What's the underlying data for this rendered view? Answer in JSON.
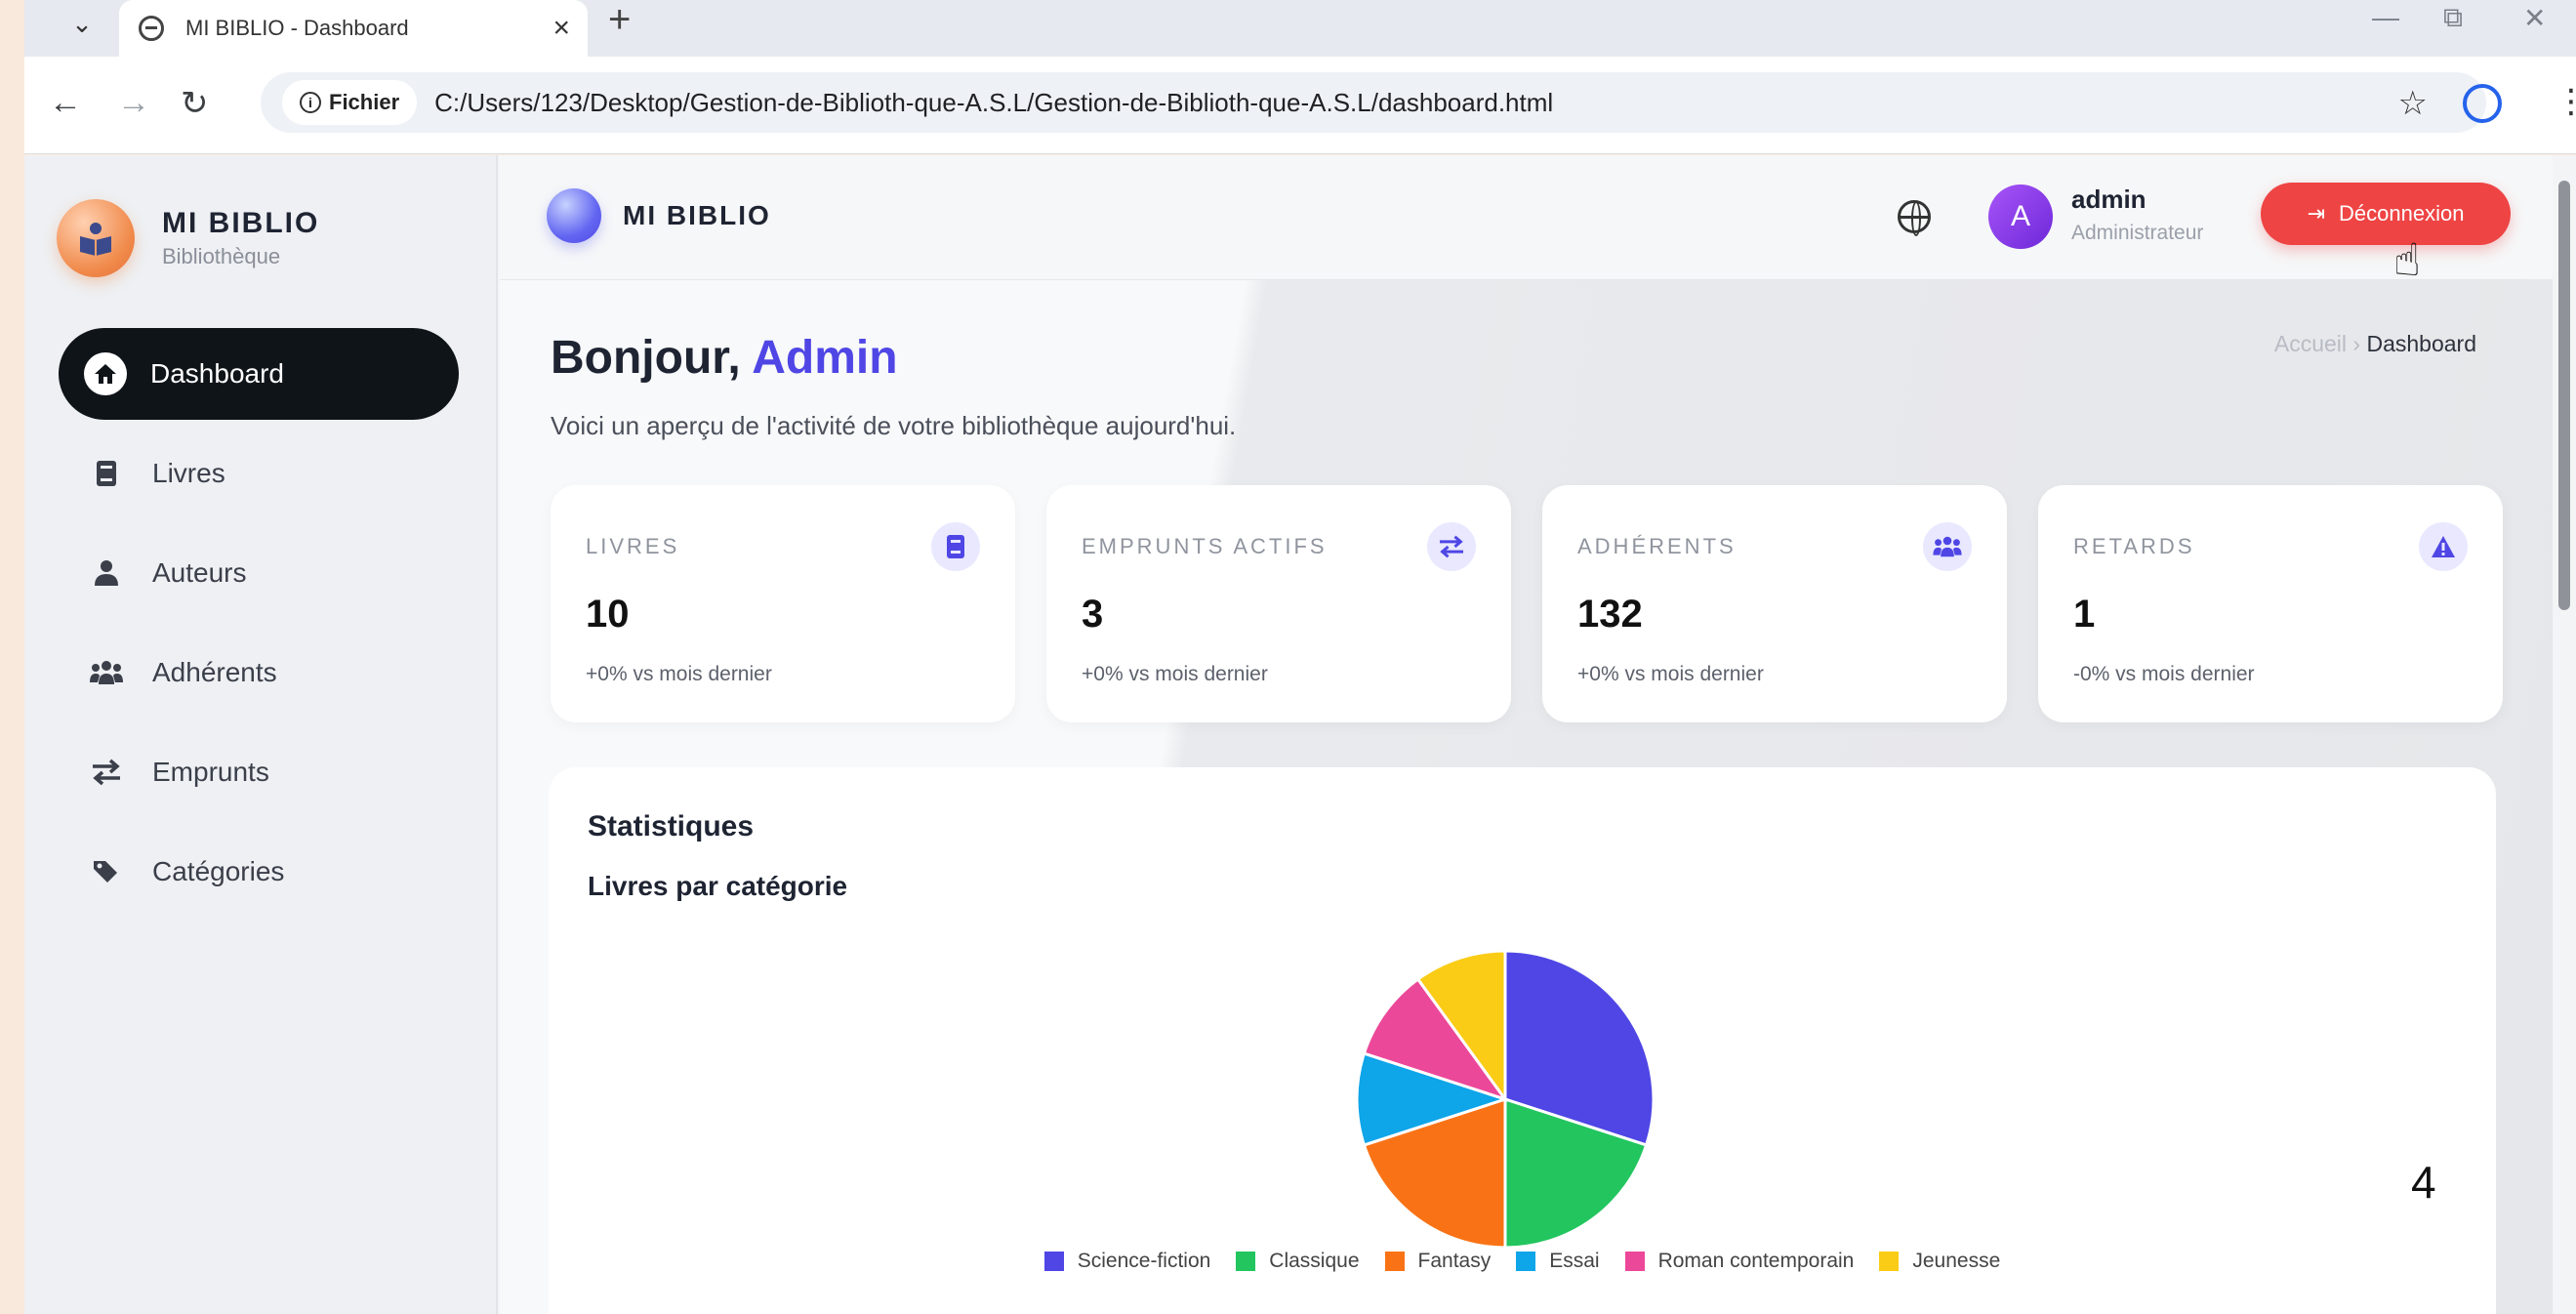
{
  "browser": {
    "tab_title": "MI BIBLIO - Dashboard",
    "tab_close": "×",
    "new_tab": "+",
    "chip_label": "Fichier",
    "url": "C:/Users/123/Desktop/Gestion-de-Biblioth-que-A.S.L/Gestion-de-Biblioth-que-A.S.L/dashboard.html"
  },
  "sidebar": {
    "brand_name": "MI BIBLIO",
    "brand_sub": "Bibliothèque",
    "items": [
      {
        "label": "Dashboard",
        "icon": "home-icon",
        "active": true
      },
      {
        "label": "Livres",
        "icon": "book-icon",
        "active": false
      },
      {
        "label": "Auteurs",
        "icon": "user-icon",
        "active": false
      },
      {
        "label": "Adhérents",
        "icon": "users-icon",
        "active": false
      },
      {
        "label": "Emprunts",
        "icon": "exchange-icon",
        "active": false
      },
      {
        "label": "Catégories",
        "icon": "tags-icon",
        "active": false
      }
    ]
  },
  "topbar": {
    "brand_name": "MI BIBLIO",
    "avatar_letter": "A",
    "user_name": "admin",
    "user_role": "Administrateur",
    "logout_label": "Déconnexion"
  },
  "header": {
    "greeting_prefix": "Bonjour,",
    "greeting_name": "Admin",
    "subtitle": "Voici un aperçu de l'activité de votre bibliothèque aujourd'hui.",
    "breadcrumb_home": "Accueil",
    "breadcrumb_sep": "›",
    "breadcrumb_current": "Dashboard"
  },
  "stats": [
    {
      "label": "LIVRES",
      "value": "10",
      "trend": "+0% vs mois dernier",
      "icon": "book-icon"
    },
    {
      "label": "EMPRUNTS ACTIFS",
      "value": "3",
      "trend": "+0% vs mois dernier",
      "icon": "exchange-icon"
    },
    {
      "label": "ADHÉRENTS",
      "value": "132",
      "trend": "+0% vs mois dernier",
      "icon": "users-icon"
    },
    {
      "label": "RETARDS",
      "value": "1",
      "trend": "-0% vs mois dernier",
      "icon": "warning-icon"
    }
  ],
  "statistics": {
    "title": "Statistiques",
    "subtitle": "Livres par catégorie"
  },
  "chart_data": {
    "type": "pie",
    "title": "Livres par catégorie",
    "legend_position": "bottom",
    "categories": [
      "Science-fiction",
      "Classique",
      "Fantasy",
      "Essai",
      "Roman contemporain",
      "Jeunesse"
    ],
    "values": [
      3,
      2,
      2,
      1,
      1,
      1
    ],
    "colors": [
      "#4f46e5",
      "#22c55e",
      "#f97316",
      "#0ea5e9",
      "#ec4899",
      "#facc15"
    ]
  },
  "page_number": "4"
}
